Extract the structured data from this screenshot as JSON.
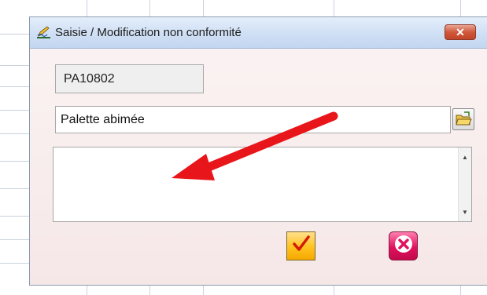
{
  "dialog": {
    "title": "Saisie / Modification non conformité",
    "close_label": "✕",
    "code_value": "PA10802",
    "label_value": "Palette abimée",
    "comment_value": "",
    "icons": {
      "title": "edit-pen-icon",
      "folder": "open-folder-icon",
      "ok": "check-icon",
      "cancel": "close-x-icon"
    }
  },
  "colors": {
    "annotation_arrow": "#e8161b",
    "ok_button": "#ffc21f",
    "cancel_button": "#e0125e"
  }
}
